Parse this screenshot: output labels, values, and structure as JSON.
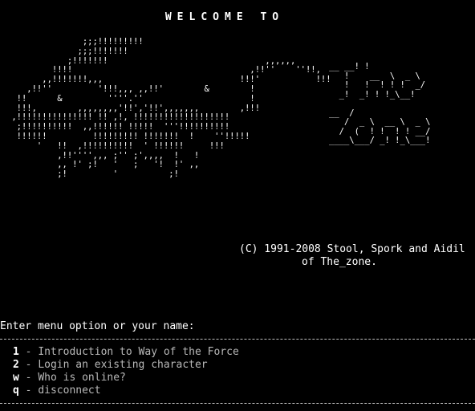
{
  "header": {
    "welcome": "WELCOME TO"
  },
  "art": {
    "ascii_image": "               ;;;!!!!!!!!!\n              ;;;!!!!!!!\n            ;!!!!!!!                               ,,,,,,\n         !!!!                                   ,!!''    ''!!,\n       ,,!!!!!!!,,,                           !!!'           !!!\n    ,!!''         '!!!,,, ,,!!'        &        !\n  !!      &         ''''.''                     !\n  !!!,        ,,,,,,,,'!!','!!',,,,,,,        ,!!!\n ,!!!!!!!!!!!!!!! !! ,!, !!!!!!!!!!!!!!!!!!!\n  ;!!!!!!!!!!  ,,!!!!!! !!!!!  '''!!!!!!!!!!\n  !!!!!!         !!!!!!!!! !!!!!!!  !    ''!!!!!\n      '   !!  ,!!!!!!!!!!  ' !!!!!!     !!!\n          ,!!'''',,, ;'' ;',,,,  !   !\n          ,, !' ;!   '   ;   '!  !' ,,\n          ;!         '          ;!",
    "logo": "__ __! !\n   !    __  \\  _ \\\n   !   !  ! ! !  _/\n  _!  _! ! !_\\__!\n\n__  /\n   /  _ \\  __ \\  _ \\\n  /  (  ! !  ! ! __/\n____\\___/ _! !_\\___!"
  },
  "copyright": {
    "line1": "(C) 1991-2008 Stool, Spork and Aidil",
    "line2": "of The_zone."
  },
  "prompt": {
    "text": "Enter menu option or your name:"
  },
  "menu": {
    "items": [
      {
        "key": "1",
        "separator": " - ",
        "label": "Introduction to Way of the Force"
      },
      {
        "key": "2",
        "separator": " - ",
        "label": "Login an existing character"
      },
      {
        "key": "w",
        "separator": " - ",
        "label": "Who is online?"
      },
      {
        "key": "q",
        "separator": " - ",
        "label": "disconnect"
      }
    ]
  },
  "colors": {
    "background": "#000000",
    "bright_text": "#ffffff",
    "dim_text": "#b8b8b8"
  }
}
